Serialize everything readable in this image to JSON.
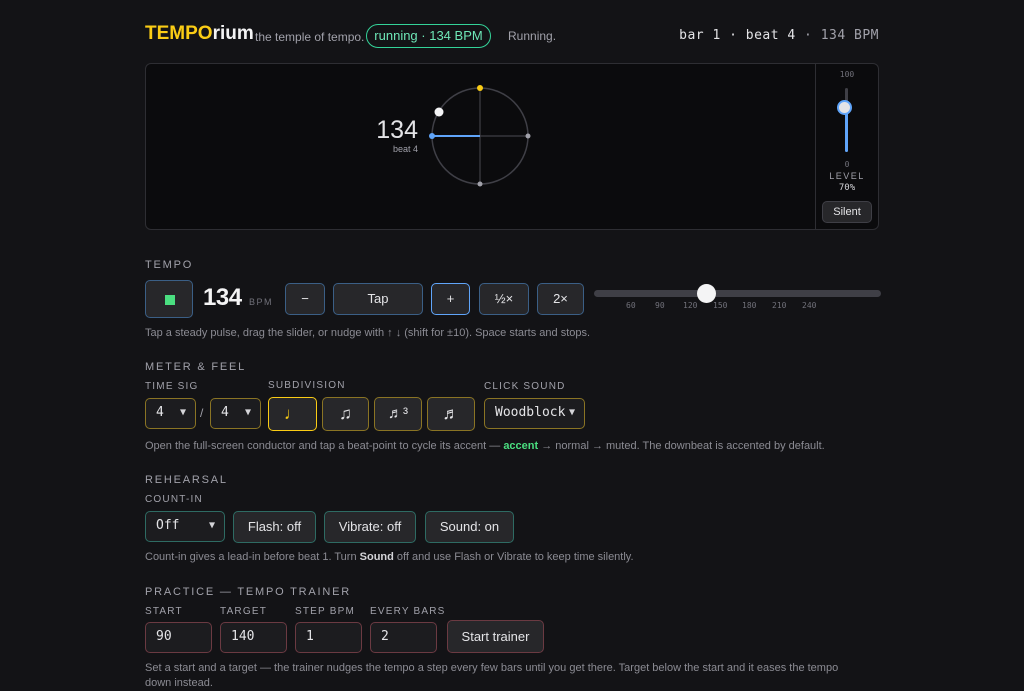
{
  "header": {
    "brand_a": "TEMPO",
    "brand_b": "rium",
    "tagline": "the temple of tempo.",
    "run_pill": "running · 134 BPM",
    "run_status": "Running.",
    "bar_text": "bar 1 · beat 4",
    "bar_sep": "·",
    "bpm_text": "134 BPM"
  },
  "stage": {
    "bpm": "134",
    "beat_label": "beat 4",
    "level_max": "100",
    "level_min": "0",
    "level_label": "LEVEL",
    "level_value": "70%",
    "level_fraction": 0.7,
    "silent_label": "Silent"
  },
  "tempo": {
    "section": "TEMPO",
    "bpm_value": "134",
    "bpm_unit": "BPM",
    "minus": "−",
    "tap": "Tap",
    "plus": "+",
    "half": "½×",
    "double": "2×",
    "slider_ticks": [
      "60",
      "90",
      "120",
      "150",
      "180",
      "210",
      "240"
    ],
    "hint": "Tap a steady pulse, drag the slider, or nudge with ↑ ↓ (shift for ±10). Space starts and stops."
  },
  "meter": {
    "section": "METER & FEEL",
    "time_sig_label": "TIME SIG",
    "beats": "4",
    "slash": "/",
    "unit": "4",
    "subdivision_label": "SUBDIVISION",
    "subdivisions": [
      "♩",
      "♫",
      "♬³",
      "♬"
    ],
    "click_label": "CLICK SOUND",
    "click_value": "Woodblock",
    "hint_a": "Open the full-screen conductor and tap a beat-point to cycle its accent — ",
    "hint_accent": "accent",
    "hint_b": " → normal → muted. The downbeat is accented by default."
  },
  "rehearsal": {
    "section": "REHEARSAL",
    "countin_label": "COUNT-IN",
    "countin_value": "Off",
    "flash": "Flash: off",
    "vibrate": "Vibrate: off",
    "sound": "Sound: on",
    "hint_a": "Count-in gives a lead-in before beat 1. Turn ",
    "hint_bold": "Sound",
    "hint_b": " off and use Flash or Vibrate to keep time silently."
  },
  "practice": {
    "section": "PRACTICE — TEMPO TRAINER",
    "start_label": "START",
    "start_value": "90",
    "target_label": "TARGET",
    "target_value": "140",
    "step_label": "STEP BPM",
    "step_value": "1",
    "every_label": "EVERY BARS",
    "every_value": "2",
    "start_button": "Start trainer",
    "hint": "Set a start and a target — the trainer nudges the tempo a step every few bars until you get there. Target below the start and it eases the tempo down instead."
  },
  "colors": {
    "accent_yellow": "#facc15",
    "running_green": "#34d399",
    "beat_blue": "#60a5fa",
    "background": "#131316"
  }
}
